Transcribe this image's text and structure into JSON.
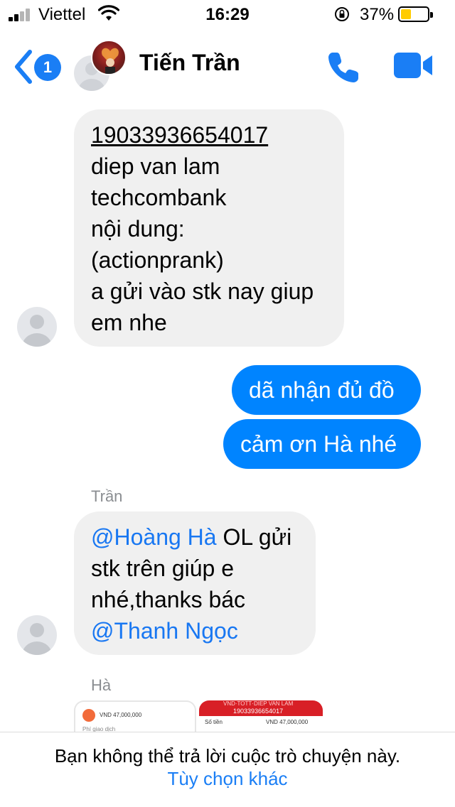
{
  "status_bar": {
    "carrier": "Viettel",
    "time": "16:29",
    "battery_percent": "37%",
    "battery_level": 0.37,
    "signal_bars": 2
  },
  "header": {
    "unread_count": "1",
    "contact_name": "Tiến Trần",
    "icons": {
      "back": "chevron-left-icon",
      "call": "phone-icon",
      "video": "video-camera-icon"
    },
    "accent_color": "#1a7ef5"
  },
  "messages": {
    "first": {
      "account_number": "19033936654017",
      "lines": [
        "diep van lam",
        "techcombank",
        "nội dung:",
        "(actionprank)",
        "a gửi vào stk nay giup",
        "em nhe"
      ]
    },
    "outgoing_1": "dã nhận đủ đồ",
    "outgoing_2": "cảm ơn Hà nhé",
    "second": {
      "sender": "Trần",
      "mention_1": "@Hoàng Hà",
      "text_1": " OL gửi",
      "line_2": "stk trên giúp e",
      "line_3": "nhé,thanks bác",
      "mention_2": "@Thanh Ngọc"
    },
    "third_sender": "Hà",
    "thumb_white": {
      "amount": "VND 47,000,000",
      "label": "Phí giao dịch"
    },
    "thumb_red": {
      "title": "VND·TOTT·DIEP VAN LAM",
      "account": "19033936654017",
      "label": "Số tiền",
      "amount": "VND 47,000,000"
    }
  },
  "colors": {
    "outgoing_bubble": "#0084ff",
    "incoming_bubble": "#f0f0f0",
    "mention": "#1877f2"
  },
  "footer": {
    "notice": "Bạn không thể trả lời cuộc trò chuyện này.",
    "more_options": "Tùy chọn khác"
  }
}
